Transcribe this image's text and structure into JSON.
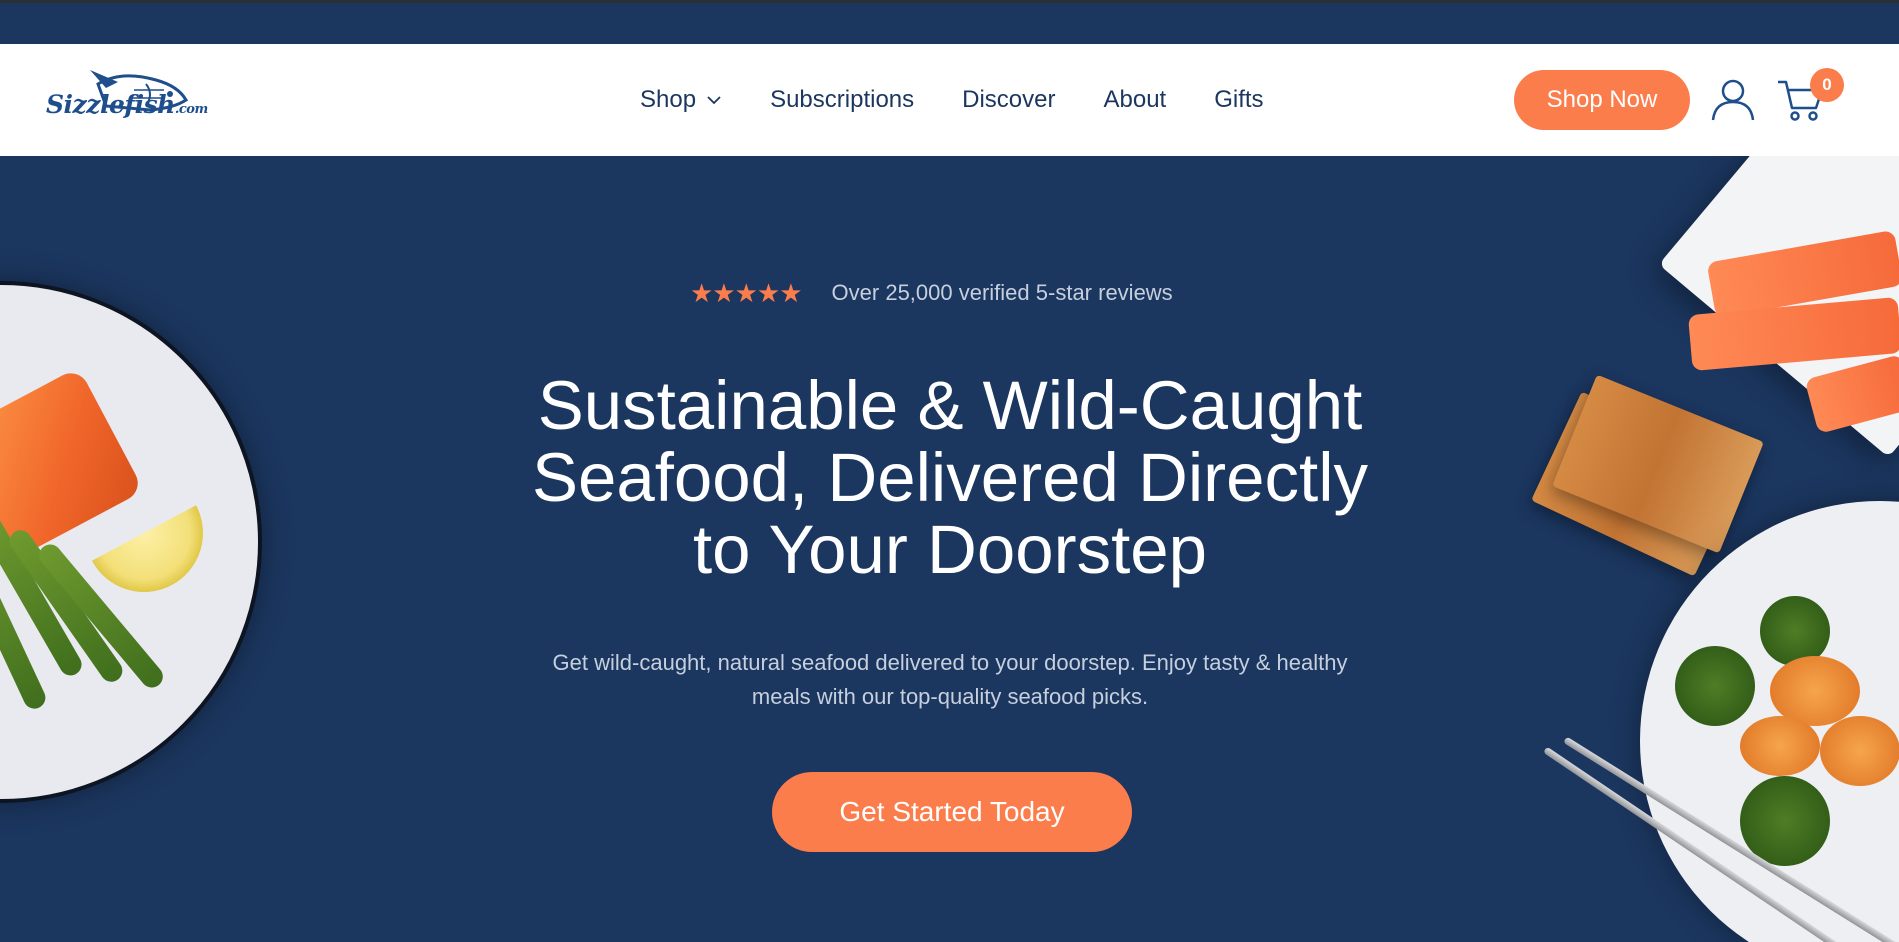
{
  "brand": {
    "logo_text": "Sizzlefish",
    "logo_suffix": ".com"
  },
  "nav": {
    "items": [
      {
        "label": "Shop",
        "has_dropdown": true
      },
      {
        "label": "Subscriptions"
      },
      {
        "label": "Discover"
      },
      {
        "label": "About"
      },
      {
        "label": "Gifts"
      }
    ]
  },
  "header": {
    "shop_now_label": "Shop Now",
    "cart_count": "0"
  },
  "hero": {
    "stars": "★★★★★",
    "reviews_text": "Over 25,000 verified 5-star reviews",
    "headline_line1": "Sustainable & Wild-Caught",
    "headline_line2": "Seafood, Delivered Directly",
    "headline_line3": "to Your Doorstep",
    "subtext_line1": "Get wild-caught, natural seafood delivered to your doorstep. Enjoy tasty & healthy",
    "subtext_line2": "meals with our top-quality seafood picks.",
    "cta_label": "Get Started Today"
  },
  "colors": {
    "navy": "#1b365f",
    "accent": "#fb7d4b",
    "white": "#ffffff",
    "muted_text": "#c6cfdd"
  }
}
